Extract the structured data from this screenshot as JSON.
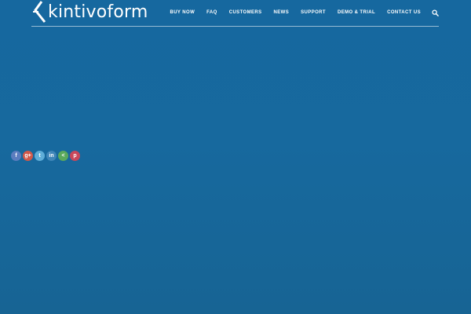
{
  "brand": {
    "name": "kintivoform"
  },
  "nav": {
    "items": [
      {
        "label": "BUY NOW"
      },
      {
        "label": "FAQ"
      },
      {
        "label": "CUSTOMERS"
      },
      {
        "label": "NEWS"
      },
      {
        "label": "SUPPORT"
      },
      {
        "label": "DEMO & TRIAL"
      },
      {
        "label": "CONTACT US"
      }
    ],
    "search_icon": "search-icon"
  },
  "share": {
    "buttons": [
      {
        "icon": "facebook-icon",
        "glyph": "f",
        "color": "#5b7dbf"
      },
      {
        "icon": "google-plus-icon",
        "glyph": "g+",
        "color": "#d0594a"
      },
      {
        "icon": "twitter-icon",
        "glyph": "t",
        "color": "#5faed8"
      },
      {
        "icon": "linkedin-icon",
        "glyph": "in",
        "color": "#3f86b8"
      },
      {
        "icon": "share-icon",
        "glyph": "<",
        "color": "#5aa95c"
      },
      {
        "icon": "pinterest-icon",
        "glyph": "p",
        "color": "#c8475a"
      }
    ]
  },
  "colors": {
    "background": "#17699e",
    "header_line": "#8fb8d6",
    "text": "#ffffff"
  }
}
